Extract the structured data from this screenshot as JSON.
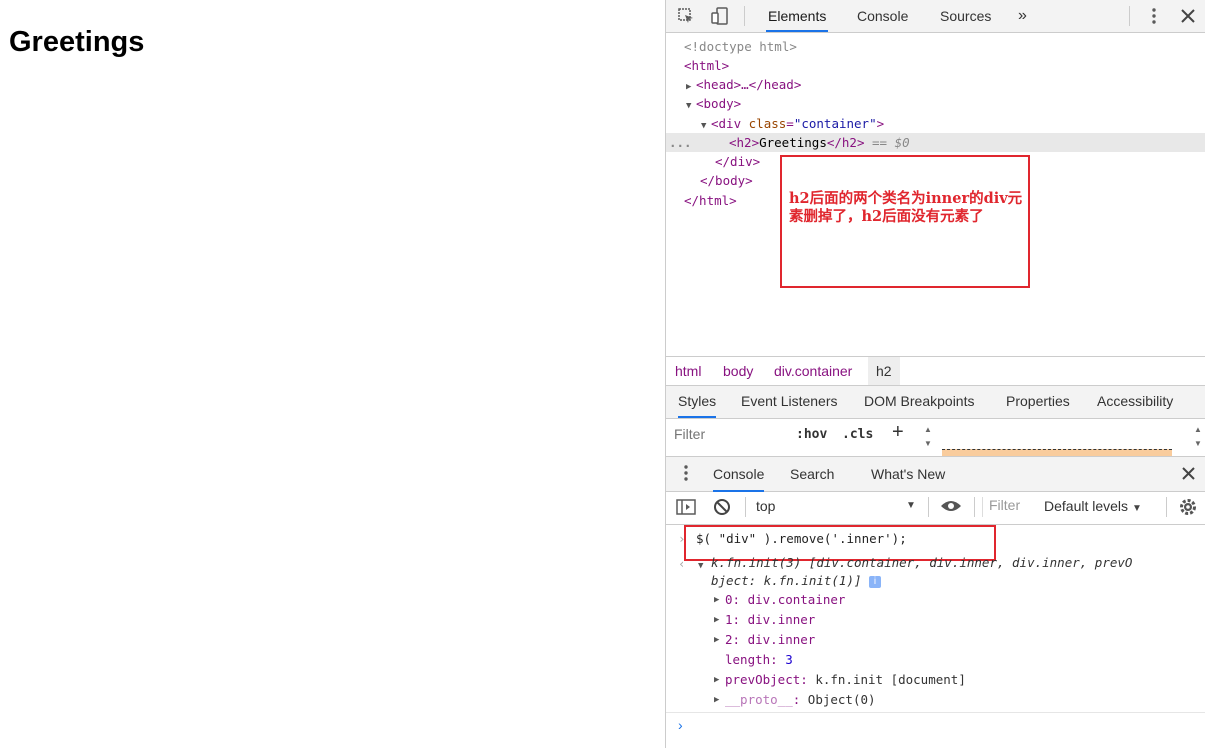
{
  "page": {
    "heading": "Greetings"
  },
  "devtools": {
    "tabs": [
      "Elements",
      "Console",
      "Sources"
    ],
    "more_tabs_icon": "»",
    "elements_tree": {
      "doctype": "<!doctype html>",
      "html_open": "<html>",
      "head": "<head>…</head>",
      "body_open": "<body>",
      "div_open_tag": "div",
      "div_attr_name": "class",
      "div_attr_value": "\"container\"",
      "h2_text": "Greetings",
      "selected_suffix": "== $0",
      "div_close": "</div>",
      "body_close": "</body>",
      "html_close": "</html>",
      "ellipsis": "..."
    },
    "annotation": "h2后面的两个类名为inner的div元素删掉了，h2后面没有元素了",
    "breadcrumbs": [
      "html",
      "body",
      "div.container",
      "h2"
    ],
    "sub_tabs": [
      "Styles",
      "Event Listeners",
      "DOM Breakpoints",
      "Properties",
      "Accessibility"
    ],
    "styles_filter_placeholder": "Filter",
    "hov_label": ":hov",
    "cls_label": ".cls",
    "drawer_tabs": [
      "Console",
      "Search",
      "What's New"
    ],
    "console_context": "top",
    "console_filter_placeholder": "Filter",
    "log_levels": "Default levels",
    "console_command": "$( \"div\" ).remove('.inner');",
    "result_summary_line1": "k.fn.init(3) [div.container, div.inner, div.inner, prevO",
    "result_summary_line2": "bject: k.fn.init(1)]",
    "result_items": [
      {
        "key": "0",
        "value": "div.container"
      },
      {
        "key": "1",
        "value": "div.inner"
      },
      {
        "key": "2",
        "value": "div.inner"
      }
    ],
    "length_key": "length",
    "length_value": "3",
    "prev_object_key": "prevObject",
    "prev_object_value": "k.fn.init [document]",
    "proto_key": "__proto__",
    "proto_value": "Object(0)"
  },
  "colors": {
    "accent": "#1a73e8",
    "annotation_red": "#e0262e",
    "tag_purple": "#881280"
  }
}
